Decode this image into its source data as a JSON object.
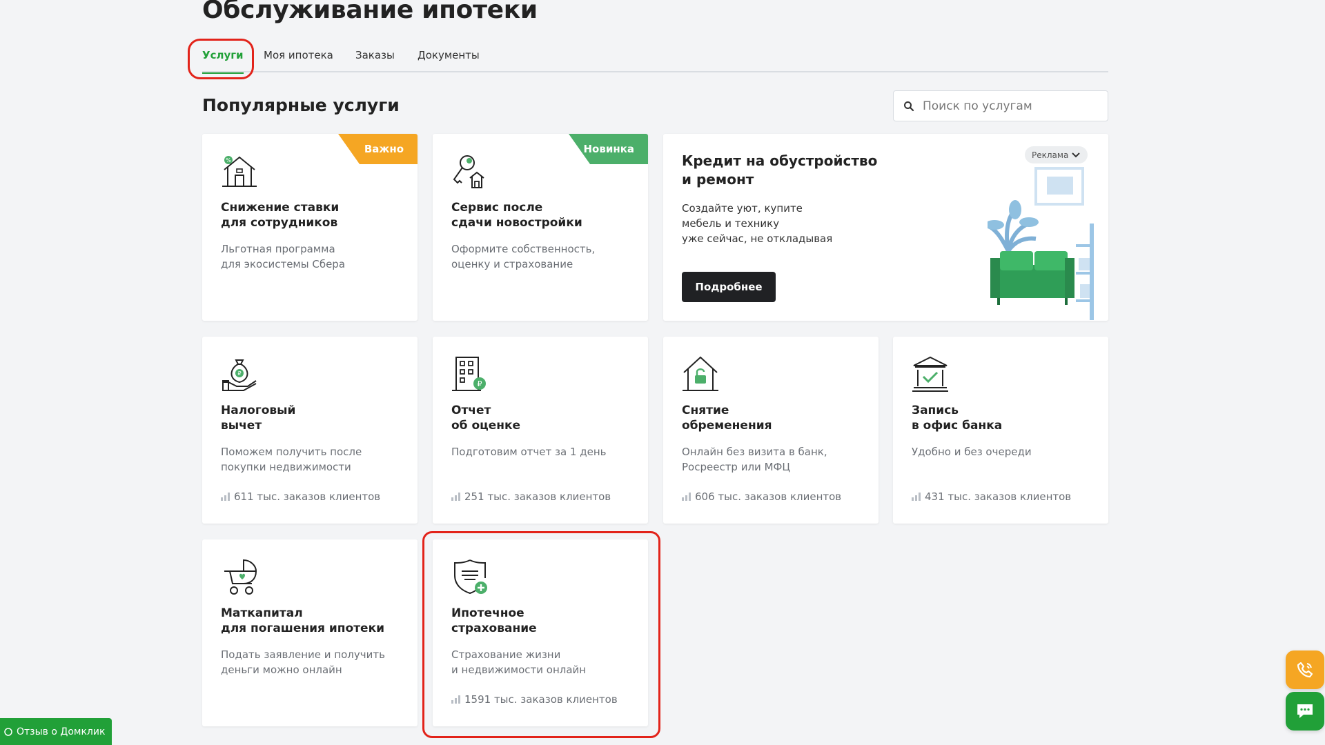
{
  "page_title": "Обслуживание ипотеки",
  "tabs": [
    {
      "label": "Услуги",
      "active": true
    },
    {
      "label": "Моя ипотека",
      "active": false
    },
    {
      "label": "Заказы",
      "active": false
    },
    {
      "label": "Документы",
      "active": false
    }
  ],
  "section_title": "Популярные услуги",
  "search": {
    "placeholder": "Поиск по услугам",
    "icon": "search-icon"
  },
  "colors": {
    "brand_green": "#21a038",
    "important_orange": "#f5a623",
    "highlight_red": "#e2231a",
    "new_green": "#4caf6a"
  },
  "cards": [
    {
      "title_lines": [
        "Снижение ставки",
        "для сотрудников"
      ],
      "desc_lines": [
        "Льготная программа",
        "для экосистемы Сбера"
      ],
      "badge": "Важно",
      "icon": "house-percent-icon"
    },
    {
      "title_lines": [
        "Сервис после",
        "сдачи новостройки"
      ],
      "desc_lines": [
        "Оформите собственность,",
        "оценку и страхование"
      ],
      "badge": "Новинка",
      "icon": "key-house-icon"
    },
    {
      "title_lines": [
        "Налоговый",
        "вычет"
      ],
      "desc_lines": [
        "Поможем получить после",
        "покупки недвижимости"
      ],
      "stat": "611 тыс. заказов клиентов",
      "icon": "money-bag-hand-icon"
    },
    {
      "title_lines": [
        "Отчет",
        "об оценке"
      ],
      "desc_lines": [
        "Подготовим отчет за 1 день"
      ],
      "stat": "251 тыс. заказов клиентов",
      "icon": "building-ruble-icon"
    },
    {
      "title_lines": [
        "Снятие",
        "обременения"
      ],
      "desc_lines": [
        "Онлайн без визита в банк,",
        "Росреестр или МФЦ"
      ],
      "stat": "606 тыс. заказов клиентов",
      "icon": "house-lock-icon"
    },
    {
      "title_lines": [
        "Запись",
        "в офис банка"
      ],
      "desc_lines": [
        "Удобно и без очереди"
      ],
      "stat": "431 тыс. заказов клиентов",
      "icon": "bank-check-icon"
    },
    {
      "title_lines": [
        "Маткапитал",
        "для погашения ипотеки"
      ],
      "desc_lines": [
        "Подать заявление и получить",
        "деньги можно онлайн"
      ],
      "icon": "stroller-icon"
    },
    {
      "title_lines": [
        "Ипотечное",
        "страхование"
      ],
      "desc_lines": [
        "Страхование жизни",
        "и недвижимости онлайн"
      ],
      "stat": "1591 тыс. заказов клиентов",
      "icon": "shield-plus-icon"
    }
  ],
  "ad": {
    "title_lines": [
      "Кредит на обустройство",
      "и ремонт"
    ],
    "desc_lines": [
      "Создайте уют, купите",
      "мебель и технику",
      "уже сейчас, не откладывая"
    ],
    "button_label": "Подробнее",
    "badge_label": "Реклама"
  },
  "feedback_label": "Отзыв о Домклик",
  "float_buttons": {
    "call_icon": "phone-icon",
    "chat_icon": "chat-icon"
  }
}
